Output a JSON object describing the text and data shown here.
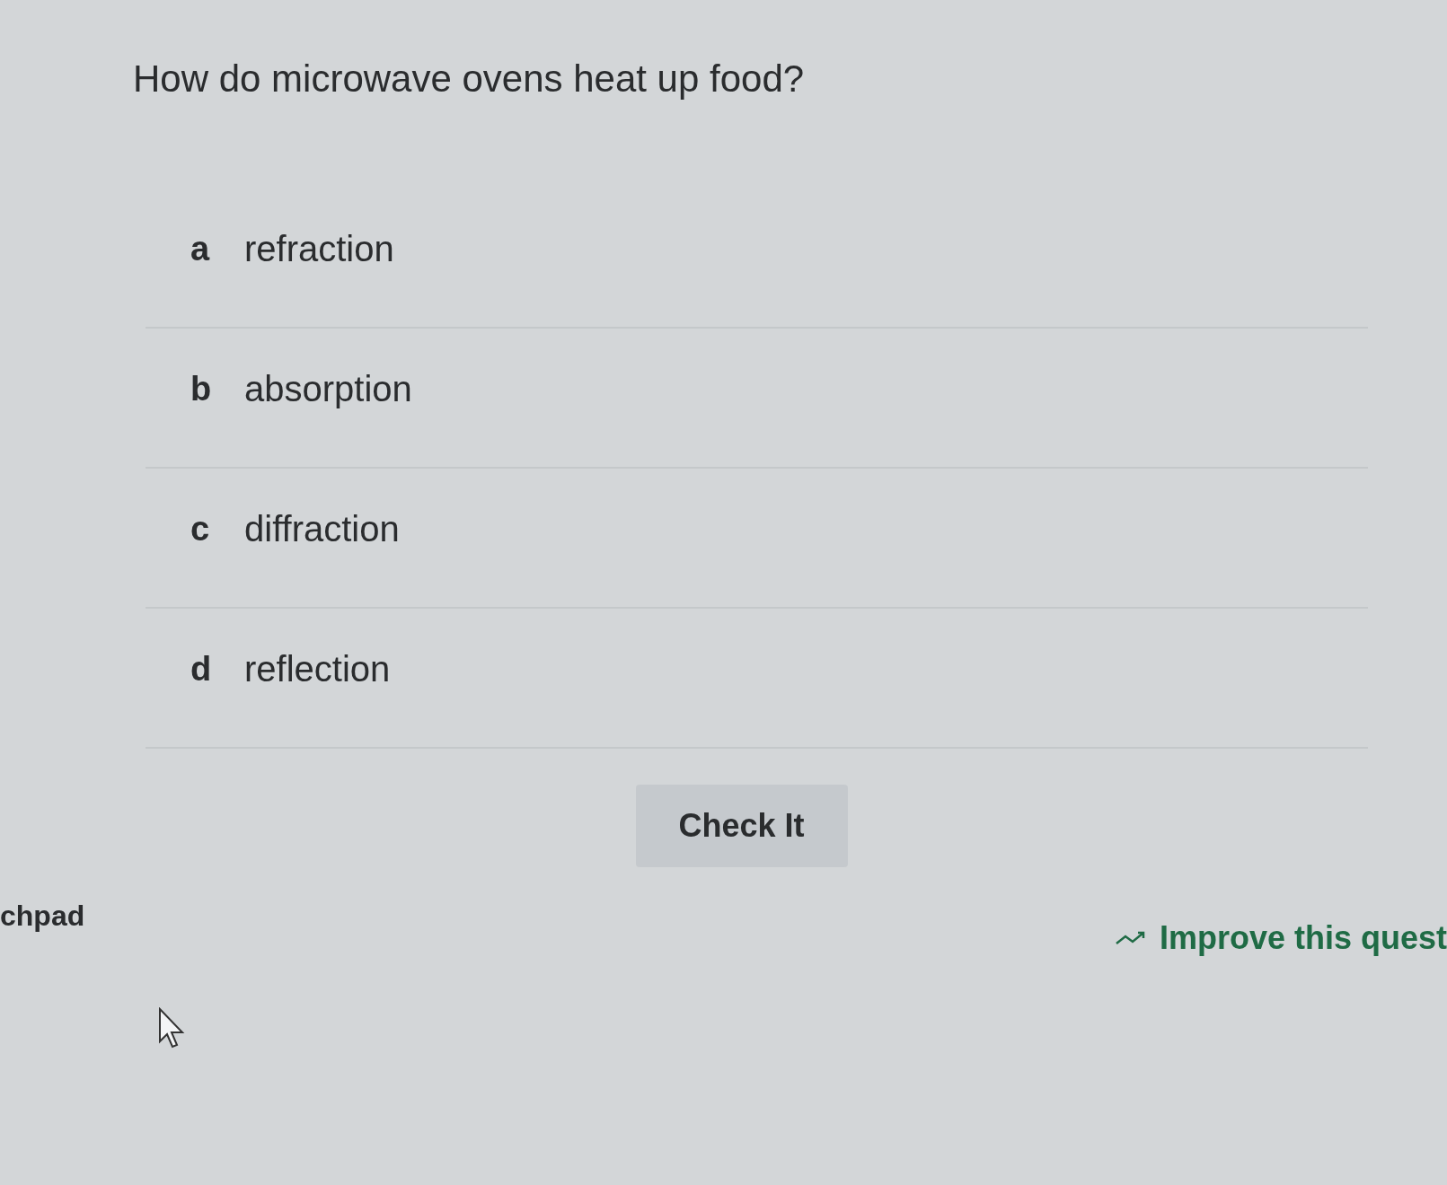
{
  "question": "How do microwave ovens heat up food?",
  "options": [
    {
      "letter": "a",
      "text": "refraction"
    },
    {
      "letter": "b",
      "text": "absorption"
    },
    {
      "letter": "c",
      "text": "diffraction"
    },
    {
      "letter": "d",
      "text": "reflection"
    }
  ],
  "check_button": "Check It",
  "left_label": "chpad",
  "improve_link": "Improve this quest"
}
